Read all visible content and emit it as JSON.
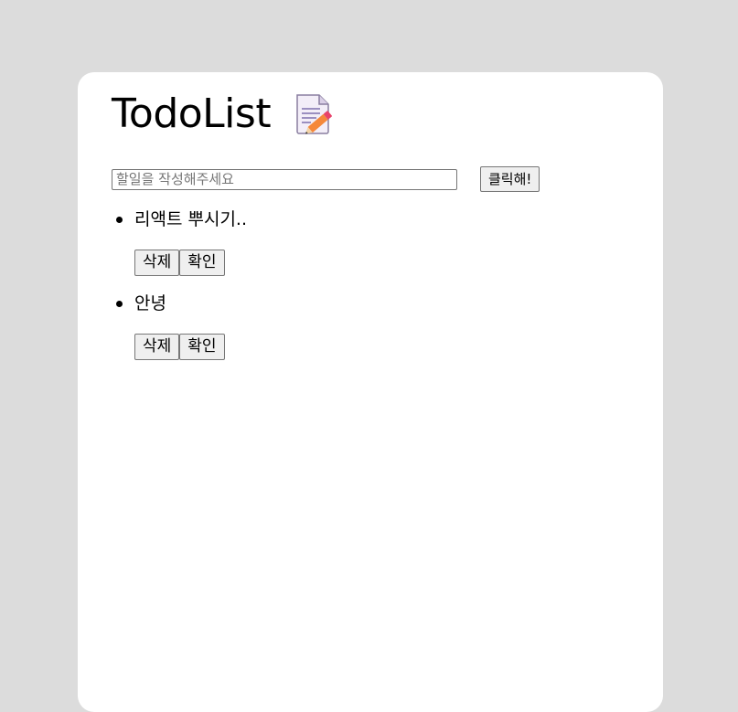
{
  "app": {
    "title": "TodoList",
    "title_icon": "memo-icon"
  },
  "input": {
    "placeholder": "할일을 작성해주세요",
    "value": "",
    "add_label": "클릭해!"
  },
  "todos": [
    {
      "text": "리액트 뿌시기..",
      "delete_label": "삭제",
      "confirm_label": "확인"
    },
    {
      "text": "안녕",
      "delete_label": "삭제",
      "confirm_label": "확인"
    }
  ],
  "colors": {
    "background": "#dcdcdc",
    "card": "#ffffff",
    "button": "#efefef",
    "border": "#767676"
  }
}
